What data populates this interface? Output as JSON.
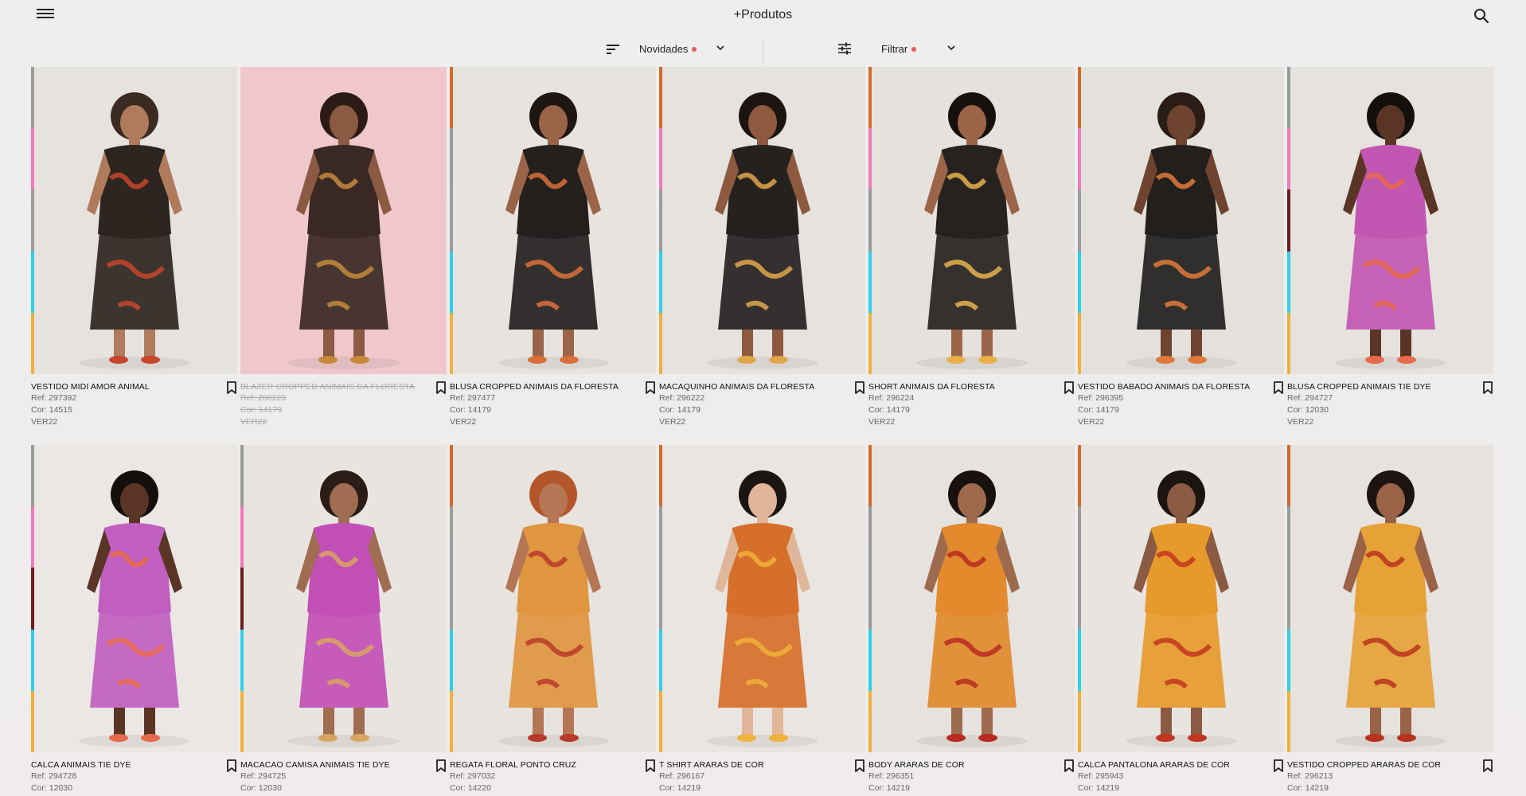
{
  "header": {
    "title": "+Produtos",
    "menu_icon": "hamburger-menu-icon",
    "search_icon": "search-icon"
  },
  "controls": {
    "sort_label": "Novidades",
    "filter_label": "Filtrar",
    "indicator_color": "#e85a5a"
  },
  "accent_stripe_colors": [
    "#9a9a9a",
    "#f07ab9",
    "#9b9b9b",
    "#2fd0ea",
    "#f0b03c",
    "#d46a2a",
    "#6a1e1e"
  ],
  "products": [
    {
      "name": "VESTIDO MIDI AMOR ANIMAL",
      "ref": "Ref: 297392",
      "cor": "Cor: 14515",
      "collection": "VER22",
      "unavailable": false,
      "bg": "#e6e3df",
      "skin": "#b07a5c",
      "hair": "#3a2a22",
      "outfit": "#2d2520",
      "accent": "#c7462b"
    },
    {
      "name": "BLAZER CROPPED ANIMAIS DA FLORESTA",
      "ref": "Ref: 286223",
      "cor": "Cor: 14179",
      "collection": "VER22",
      "unavailable": true,
      "bg": "#f0c8cc",
      "skin": "#8a5a42",
      "hair": "#2c1b14",
      "outfit": "#3a2824",
      "accent": "#c68a3a"
    },
    {
      "name": "BLUSA CROPPED ANIMAIS DA FLORESTA",
      "ref": "Ref: 297477",
      "cor": "Cor: 14179",
      "collection": "VER22",
      "unavailable": false,
      "bg": "#e7e4e0",
      "skin": "#9a6448",
      "hair": "#1e1612",
      "outfit": "#23201e",
      "accent": "#d9703a"
    },
    {
      "name": "MACAQUINHO ANIMAIS DA FLORESTA",
      "ref": "Ref: 296222",
      "cor": "Cor: 14179",
      "collection": "VER22",
      "unavailable": false,
      "bg": "#e6e3df",
      "skin": "#8d5a40",
      "hair": "#1c1410",
      "outfit": "#25211f",
      "accent": "#e0a64a"
    },
    {
      "name": "SHORT ANIMAIS DA FLORESTA",
      "ref": "Ref: 296224",
      "cor": "Cor: 14179",
      "collection": "VER22",
      "unavailable": false,
      "bg": "#e5e2de",
      "skin": "#9c6549",
      "hair": "#17110d",
      "outfit": "#262220",
      "accent": "#e8b14c"
    },
    {
      "name": "VESTIDO BABADO ANIMAIS DA FLORESTA",
      "ref": "Ref: 296395",
      "cor": "Cor: 14179",
      "collection": "VER22",
      "unavailable": false,
      "bg": "#e4e1dd",
      "skin": "#6e4330",
      "hair": "#2a1d16",
      "outfit": "#221f1d",
      "accent": "#e07a3a"
    },
    {
      "name": "BLUSA CROPPED ANIMAIS TIE DYE",
      "ref": "Ref: 294727",
      "cor": "Cor: 12030",
      "collection": "VER22",
      "unavailable": false,
      "bg": "#e6e2de",
      "skin": "#5a3526",
      "hair": "#140f0c",
      "outfit": "#c257b3",
      "accent": "#e86a4a"
    },
    {
      "name": "CALCA ANIMAIS TIE DYE",
      "ref": "Ref: 294728",
      "cor": "Cor: 12030",
      "collection": "",
      "unavailable": false,
      "bg": "#ebe7e4",
      "skin": "#5a3526",
      "hair": "#140f0c",
      "outfit": "#c15fc0",
      "accent": "#e86a4a"
    },
    {
      "name": "MACACAO CAMISA ANIMAIS TIE DYE",
      "ref": "Ref: 294725",
      "cor": "Cor: 12030",
      "collection": "",
      "unavailable": false,
      "bg": "#e8e4e0",
      "skin": "#a06c52",
      "hair": "#2a1d17",
      "outfit": "#c24fb6",
      "accent": "#d9a561"
    },
    {
      "name": "REGATA FLORAL PONTO CRUZ",
      "ref": "Ref: 297032",
      "cor": "Cor: 14220",
      "collection": "",
      "unavailable": false,
      "bg": "#e7e3de",
      "skin": "#b47654",
      "hair": "#b4562a",
      "outfit": "#e0953f",
      "accent": "#b83a2a"
    },
    {
      "name": "T SHIRT ARARAS DE COR",
      "ref": "Ref: 296167",
      "cor": "Cor: 14219",
      "collection": "",
      "unavailable": false,
      "bg": "#e9e5e1",
      "skin": "#e0b69a",
      "hair": "#1a1412",
      "outfit": "#d66f2a",
      "accent": "#f0b13a"
    },
    {
      "name": "BODY ARARAS DE COR",
      "ref": "Ref: 296351",
      "cor": "Cor: 14219",
      "collection": "",
      "unavailable": false,
      "bg": "#e6e2de",
      "skin": "#9d6a4e",
      "hair": "#18110e",
      "outfit": "#e28a2c",
      "accent": "#b82a20"
    },
    {
      "name": "CALCA PANTALONA ARARAS DE COR",
      "ref": "Ref: 295943",
      "cor": "Cor: 14219",
      "collection": "",
      "unavailable": false,
      "bg": "#e8e4e0",
      "skin": "#8a5a42",
      "hair": "#1c1410",
      "outfit": "#e79a2c",
      "accent": "#c2361f"
    },
    {
      "name": "VESTIDO CROPPED ARARAS DE COR",
      "ref": "Ref: 296213",
      "cor": "Cor: 14219",
      "collection": "",
      "unavailable": false,
      "bg": "#e6e2de",
      "skin": "#9a6246",
      "hair": "#1c1410",
      "outfit": "#e6a236",
      "accent": "#b8321e"
    }
  ]
}
